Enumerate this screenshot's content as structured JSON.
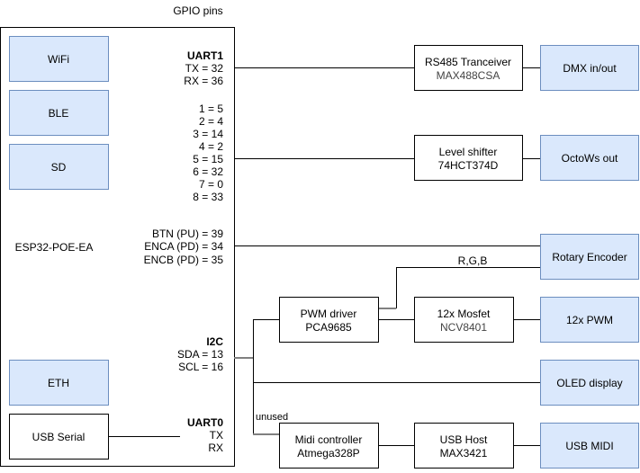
{
  "title": "GPIO pins",
  "esp": {
    "label": "ESP32-POE-EA",
    "modules": [
      "WiFi",
      "BLE",
      "SD",
      "ETH",
      "USB Serial"
    ],
    "uart1": {
      "title": "UART1",
      "lines": [
        "TX = 32",
        "RX = 36"
      ]
    },
    "octows_pins": [
      "1 =   5",
      "2 =   4",
      "3 = 14",
      "4 =   2",
      "5 = 15",
      "6 = 32",
      "7 =   0",
      "8 = 33"
    ],
    "encoder_pins": [
      "BTN (PU) = 39",
      "ENCA (PD) = 34",
      "ENCB (PD) = 35"
    ],
    "i2c": {
      "title": "I2C",
      "lines": [
        "SDA = 13",
        "SCL = 16"
      ]
    },
    "uart0": {
      "title": "UART0",
      "lines": [
        "TX",
        "RX"
      ]
    }
  },
  "blocks": {
    "rs485": [
      "RS485 Tranceiver",
      "MAX488CSA"
    ],
    "level": [
      "Level shifter",
      "74HCT374D"
    ],
    "pwm": [
      "PWM driver",
      "PCA9685"
    ],
    "mosfet": [
      "12x Mosfet",
      "NCV8401"
    ],
    "midi": [
      "Midi controller",
      "Atmega328P"
    ],
    "usbhost": [
      "USB Host",
      "MAX3421"
    ]
  },
  "outputs": [
    "DMX in/out",
    "OctoWs out",
    "Rotary Encoder",
    "12x PWM",
    "OLED display",
    "USB MIDI"
  ],
  "labels": {
    "rgb": "R,G,B",
    "unused": "unused"
  },
  "colors": {
    "module_fill": "#dae8fc",
    "module_stroke": "#6c8ebf"
  }
}
